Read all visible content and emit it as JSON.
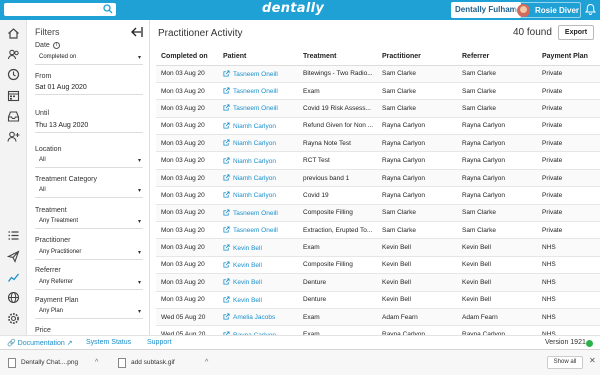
{
  "topbar": {
    "logo": "dentally",
    "practice": "Dentally Fulham",
    "user": "Rosie Diver",
    "colors": {
      "brand": "#1fa1d6"
    }
  },
  "sidebar_icons": [
    "home-icon",
    "users-icon",
    "clock-icon",
    "calendar-icon",
    "inbox-icon",
    "add-user-icon",
    "list-icon",
    "send-icon",
    "chart-icon",
    "globe-icon",
    "settings-icon"
  ],
  "filters": {
    "title": "Filters",
    "date_label": "Date",
    "date_value": "Completed on",
    "from_label": "From",
    "from_value": "Sat 01 Aug 2020",
    "until_label": "Until",
    "until_value": "Thu 13 Aug 2020",
    "location_label": "Location",
    "location_value": "All",
    "tc_label": "Treatment Category",
    "tc_value": "All",
    "treatment_label": "Treatment",
    "treatment_value": "Any Treatment",
    "practitioner_label": "Practitioner",
    "practitioner_value": "Any Practitioner",
    "referrer_label": "Referrer",
    "referrer_value": "Any Referrer",
    "plan_label": "Payment Plan",
    "plan_value": "Any Plan",
    "price_label": "Price"
  },
  "main": {
    "title": "Practitioner Activity",
    "found": "40 found",
    "export": "Export",
    "columns": [
      "Completed on",
      "Patient",
      "Treatment",
      "Practitioner",
      "Referrer",
      "Payment Plan"
    ],
    "rows": [
      [
        "Mon 03 Aug 20",
        "Tasneem Oneill",
        "Bitewings - Two Radio...",
        "Sam Clarke",
        "Sam Clarke",
        "Private"
      ],
      [
        "Mon 03 Aug 20",
        "Tasneem Oneill",
        "Exam",
        "Sam Clarke",
        "Sam Clarke",
        "Private"
      ],
      [
        "Mon 03 Aug 20",
        "Tasneem Oneill",
        "Covid 19 Risk Assess...",
        "Sam Clarke",
        "Sam Clarke",
        "Private"
      ],
      [
        "Mon 03 Aug 20",
        "Niamh Carlyon",
        "Refund Given for Non ...",
        "Rayna Carlyon",
        "Rayna Carlyon",
        "Private"
      ],
      [
        "Mon 03 Aug 20",
        "Niamh Carlyon",
        "Rayna Note Test",
        "Rayna Carlyon",
        "Rayna Carlyon",
        "Private"
      ],
      [
        "Mon 03 Aug 20",
        "Niamh Carlyon",
        "RCT Test",
        "Rayna Carlyon",
        "Rayna Carlyon",
        "Private"
      ],
      [
        "Mon 03 Aug 20",
        "Niamh Carlyon",
        "previous band 1",
        "Rayna Carlyon",
        "Rayna Carlyon",
        "Private"
      ],
      [
        "Mon 03 Aug 20",
        "Niamh Carlyon",
        "Covid 19",
        "Rayna Carlyon",
        "Rayna Carlyon",
        "Private"
      ],
      [
        "Mon 03 Aug 20",
        "Tasneem Oneill",
        "Composite Filling",
        "Sam Clarke",
        "Sam Clarke",
        "Private"
      ],
      [
        "Mon 03 Aug 20",
        "Tasneem Oneill",
        "Extraction, Erupted To...",
        "Sam Clarke",
        "Sam Clarke",
        "Private"
      ],
      [
        "Mon 03 Aug 20",
        "Kevin Bell",
        "Exam",
        "Kevin Bell",
        "Kevin Bell",
        "NHS"
      ],
      [
        "Mon 03 Aug 20",
        "Kevin Bell",
        "Composite Filling",
        "Kevin Bell",
        "Kevin Bell",
        "NHS"
      ],
      [
        "Mon 03 Aug 20",
        "Kevin Bell",
        "Denture",
        "Kevin Bell",
        "Kevin Bell",
        "NHS"
      ],
      [
        "Mon 03 Aug 20",
        "Kevin Bell",
        "Denture",
        "Kevin Bell",
        "Kevin Bell",
        "NHS"
      ],
      [
        "Wed 05 Aug 20",
        "Amelia Jacobs",
        "Exam",
        "Adam Fearn",
        "Adam Fearn",
        "NHS"
      ],
      [
        "Wed 05 Aug 20",
        "Rayna Carlyon",
        "Exam",
        "Rayna Carlyon",
        "Rayna Carlyon",
        "NHS"
      ]
    ]
  },
  "footer": {
    "documentation": "Documentation",
    "system_status": "System Status",
    "support": "Support",
    "version": "Version 1921"
  },
  "downloads": {
    "file1": "Dentally Chat....png",
    "file2": "add subtask.gif",
    "show_all": "Show all"
  }
}
